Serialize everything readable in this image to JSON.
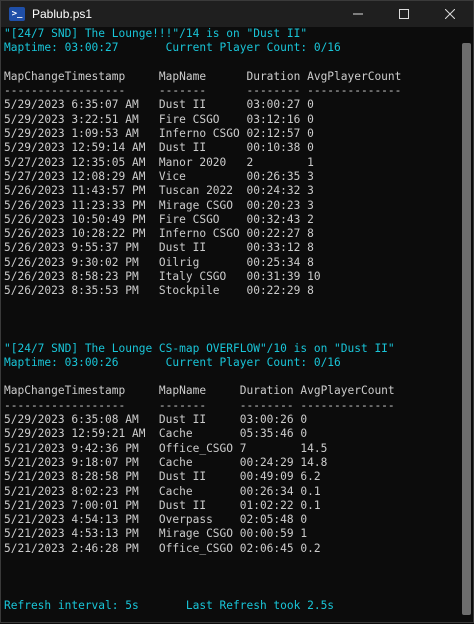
{
  "window": {
    "title": "Pablub.ps1",
    "icon": "powershell-icon",
    "controls": {
      "minimize": "minimize-icon",
      "maximize": "maximize-icon",
      "close": "close-icon"
    }
  },
  "colors": {
    "highlight": "#19c5d8",
    "text": "#cccccc",
    "background": "#0c0c0c"
  },
  "console": {
    "lines": [
      {
        "text": "\"[24/7 SND] The Lounge!!!\"/14 is on \"Dust II\"",
        "style": "cyan"
      },
      {
        "text": "Maptime: 03:00:27       Current Player Count: 0/16",
        "style": "cyan"
      },
      {
        "text": "",
        "style": "normal"
      },
      {
        "text": "MapChangeTimestamp     MapName      Duration AvgPlayerCount",
        "style": "normal"
      },
      {
        "text": "------------------     -------      -------- --------------",
        "style": "normal"
      },
      {
        "text": "5/29/2023 6:35:07 AM   Dust II      03:00:27 0",
        "style": "normal"
      },
      {
        "text": "5/29/2023 3:22:51 AM   Fire CSGO    03:12:16 0",
        "style": "normal"
      },
      {
        "text": "5/29/2023 1:09:53 AM   Inferno CSGO 02:12:57 0",
        "style": "normal"
      },
      {
        "text": "5/29/2023 12:59:14 AM  Dust II      00:10:38 0",
        "style": "normal"
      },
      {
        "text": "5/27/2023 12:35:05 AM  Manor 2020   2        1",
        "style": "normal"
      },
      {
        "text": "5/27/2023 12:08:29 AM  Vice         00:26:35 3",
        "style": "normal"
      },
      {
        "text": "5/26/2023 11:43:57 PM  Tuscan 2022  00:24:32 3",
        "style": "normal"
      },
      {
        "text": "5/26/2023 11:23:33 PM  Mirage CSGO  00:20:23 3",
        "style": "normal"
      },
      {
        "text": "5/26/2023 10:50:49 PM  Fire CSGO    00:32:43 2",
        "style": "normal"
      },
      {
        "text": "5/26/2023 10:28:22 PM  Inferno CSGO 00:22:27 8",
        "style": "normal"
      },
      {
        "text": "5/26/2023 9:55:37 PM   Dust II      00:33:12 8",
        "style": "normal"
      },
      {
        "text": "5/26/2023 9:30:02 PM   Oilrig       00:25:34 8",
        "style": "normal"
      },
      {
        "text": "5/26/2023 8:58:23 PM   Italy CSGO   00:31:39 10",
        "style": "normal"
      },
      {
        "text": "5/26/2023 8:35:53 PM   Stockpile    00:22:29 8",
        "style": "normal"
      },
      {
        "text": "",
        "style": "normal"
      },
      {
        "text": "",
        "style": "normal"
      },
      {
        "text": "",
        "style": "normal"
      },
      {
        "text": "\"[24/7 SND] The Lounge CS-map OVERFLOW\"/10 is on \"Dust II\"",
        "style": "cyan"
      },
      {
        "text": "Maptime: 03:00:26       Current Player Count: 0/16",
        "style": "cyan"
      },
      {
        "text": "",
        "style": "normal"
      },
      {
        "text": "MapChangeTimestamp     MapName     Duration AvgPlayerCount",
        "style": "normal"
      },
      {
        "text": "------------------     -------     -------- --------------",
        "style": "normal"
      },
      {
        "text": "5/29/2023 6:35:08 AM   Dust II     03:00:26 0",
        "style": "normal"
      },
      {
        "text": "5/29/2023 12:59:21 AM  Cache       05:35:46 0",
        "style": "normal"
      },
      {
        "text": "5/21/2023 9:42:36 PM   Office_CSGO 7        14.5",
        "style": "normal"
      },
      {
        "text": "5/21/2023 9:18:07 PM   Cache       00:24:29 14.8",
        "style": "normal"
      },
      {
        "text": "5/21/2023 8:28:58 PM   Dust II     00:49:09 6.2",
        "style": "normal"
      },
      {
        "text": "5/21/2023 8:02:23 PM   Cache       00:26:34 0.1",
        "style": "normal"
      },
      {
        "text": "5/21/2023 7:00:01 PM   Dust II     01:02:22 0.1",
        "style": "normal"
      },
      {
        "text": "5/21/2023 4:54:13 PM   Overpass    02:05:48 0",
        "style": "normal"
      },
      {
        "text": "5/21/2023 4:53:13 PM   Mirage CSGO 00:00:59 1",
        "style": "normal"
      },
      {
        "text": "5/21/2023 2:46:28 PM   Office_CSGO 02:06:45 0.2",
        "style": "normal"
      },
      {
        "text": "",
        "style": "normal"
      },
      {
        "text": "",
        "style": "normal"
      },
      {
        "text": "",
        "style": "normal"
      },
      {
        "text": "Refresh interval: 5s       Last Refresh took 2.5s",
        "style": "cyan"
      }
    ]
  }
}
